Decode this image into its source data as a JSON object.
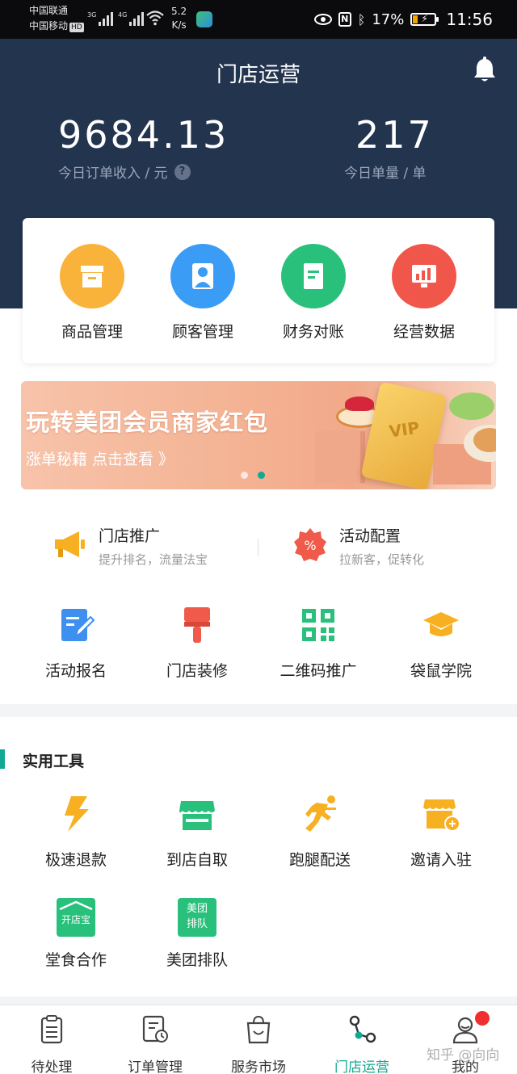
{
  "status_bar": {
    "carrier_1": "中国联通",
    "carrier_2": "中国移动",
    "hd": "HD",
    "net_1": "3G",
    "net_2": "4G",
    "speed_value": "5.2",
    "speed_unit": "K/s",
    "nfc": "N",
    "battery": "17%",
    "time": "11:56"
  },
  "header": {
    "title": "门店运营",
    "income_value": "9684.13",
    "income_label": "今日订单收入 / 元",
    "help": "?",
    "orders_value": "217",
    "orders_label": "今日单量 / 单"
  },
  "management": [
    {
      "label": "商品管理",
      "icon": "box-icon",
      "color": "#f9b23a"
    },
    {
      "label": "顾客管理",
      "icon": "user-icon",
      "color": "#3a9cf5"
    },
    {
      "label": "财务对账",
      "icon": "ledger-icon",
      "color": "#29c07c"
    },
    {
      "label": "经营数据",
      "icon": "chart-icon",
      "color": "#f0564a"
    }
  ],
  "banner": {
    "title": "玩转美团会员商家红包",
    "subtitle": "涨单秘籍 点击查看 》",
    "card_text": "VIP"
  },
  "promos": [
    {
      "title": "门店推广",
      "subtitle": "提升排名，流量法宝",
      "icon": "megaphone-icon"
    },
    {
      "title": "活动配置",
      "subtitle": "拉新客，促转化",
      "icon": "discount-icon"
    }
  ],
  "features": [
    {
      "label": "活动报名",
      "icon": "edit-form-icon"
    },
    {
      "label": "门店装修",
      "icon": "paint-brush-icon"
    },
    {
      "label": "二维码推广",
      "icon": "qrcode-icon"
    },
    {
      "label": "袋鼠学院",
      "icon": "graduation-cap-icon"
    }
  ],
  "tools": {
    "title": "实用工具",
    "items": [
      {
        "label": "极速退款",
        "icon": "lightning-icon"
      },
      {
        "label": "到店自取",
        "icon": "storefront-icon"
      },
      {
        "label": "跑腿配送",
        "icon": "runner-icon"
      },
      {
        "label": "邀请入驻",
        "icon": "store-add-icon"
      },
      {
        "label": "堂食合作",
        "icon": "kaidianbao-icon",
        "icon_text": "开店宝"
      },
      {
        "label": "美团排队",
        "icon": "meituan-queue-icon",
        "icon_text": "美团排队"
      }
    ]
  },
  "tabs": [
    {
      "label": "待处理",
      "icon": "clipboard-icon"
    },
    {
      "label": "订单管理",
      "icon": "order-list-icon"
    },
    {
      "label": "服务市场",
      "icon": "shopping-bag-icon"
    },
    {
      "label": "门店运营",
      "icon": "nodes-icon",
      "active": true
    },
    {
      "label": "我的",
      "icon": "profile-icon"
    }
  ],
  "watermark": "知乎 @向向",
  "colors": {
    "header_bg": "#23344f",
    "accent": "#12a891",
    "badge_red": "#f03030"
  }
}
